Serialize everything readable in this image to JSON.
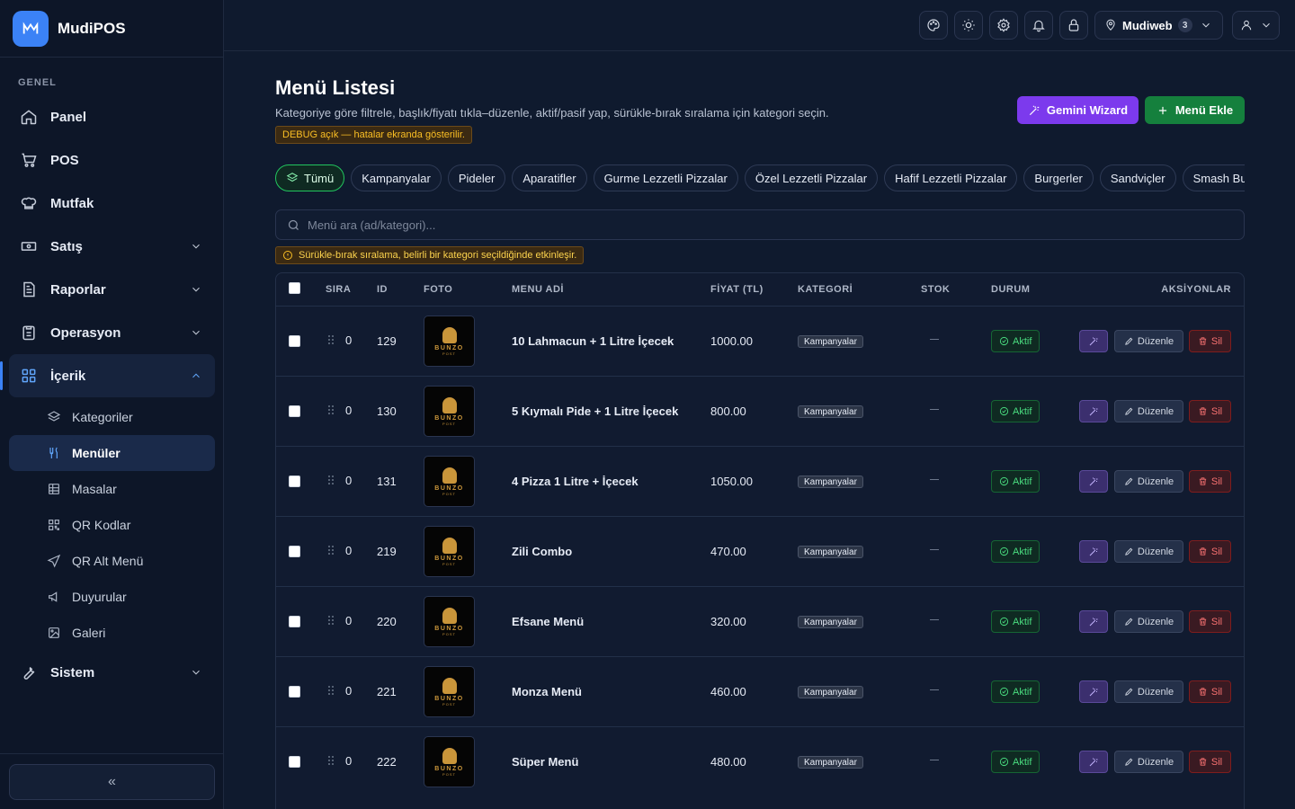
{
  "brand": {
    "logo": "M",
    "name": "MudiPOS"
  },
  "sidebar": {
    "section_label": "GENEL",
    "items": [
      {
        "label": "Panel",
        "icon": "home-icon"
      },
      {
        "label": "POS",
        "icon": "cart-icon"
      },
      {
        "label": "Mutfak",
        "icon": "chef-icon"
      },
      {
        "label": "Satış",
        "icon": "cash-icon",
        "chevron": "down"
      },
      {
        "label": "Raporlar",
        "icon": "report-icon",
        "chevron": "down"
      },
      {
        "label": "Operasyon",
        "icon": "clipboard-icon",
        "chevron": "down"
      },
      {
        "label": "İçerik",
        "icon": "grid-icon",
        "chevron": "up",
        "active": true
      },
      {
        "label": "Sistem",
        "icon": "wrench-icon",
        "chevron": "down"
      }
    ],
    "sub_items": [
      {
        "label": "Kategoriler",
        "icon": "layers-icon"
      },
      {
        "label": "Menüler",
        "icon": "utensils-icon",
        "active": true
      },
      {
        "label": "Masalar",
        "icon": "table-icon"
      },
      {
        "label": "QR Kodlar",
        "icon": "qr-icon"
      },
      {
        "label": "QR Alt Menü",
        "icon": "send-icon"
      },
      {
        "label": "Duyurular",
        "icon": "megaphone-icon"
      },
      {
        "label": "Galeri",
        "icon": "image-icon"
      }
    ],
    "collapse_label": "«"
  },
  "topbar": {
    "user_label": "Mudiweb",
    "user_count": "3"
  },
  "page": {
    "title": "Menü Listesi",
    "subtitle": "Kategoriye göre filtrele, başlık/fiyatı tıkla–düzenle, aktif/pasif yap, sürükle-bırak sıralama için kategori seçin.",
    "debug": "DEBUG açık — hatalar ekranda gösterilir.",
    "gemini_label": "Gemini Wizard",
    "add_label": "Menü Ekle",
    "search_placeholder": "Menü ara (ad/kategori)...",
    "warning": "Sürükle-bırak sıralama, belirli bir kategori seçildiğinde etkinleşir."
  },
  "chips": [
    "Tümü",
    "Kampanyalar",
    "Pideler",
    "Aparatifler",
    "Gurme Lezzetli Pizzalar",
    "Özel Lezzetli Pizzalar",
    "Hafif Lezzetli Pizzalar",
    "Burgerler",
    "Sandviçler",
    "Smash Burger"
  ],
  "table": {
    "headers": {
      "sira": "SIRA",
      "id": "ID",
      "foto": "FOTO",
      "menu": "MENU ADİ",
      "fiyat": "FİYAT (TL)",
      "kategori": "KATEGORİ",
      "stok": "STOK",
      "durum": "DURUM",
      "aksiyon": "AKSİYONLAR"
    },
    "photo_brand": "BUNZO",
    "photo_brand_sub": "POST",
    "status_label": "Aktif",
    "edit_label": "Düzenle",
    "delete_label": "Sil",
    "rows": [
      {
        "sira": "0",
        "id": "129",
        "name": "10 Lahmacun + 1 Litre İçecek",
        "price": "1000.00",
        "category": "Kampanyalar"
      },
      {
        "sira": "0",
        "id": "130",
        "name": "5 Kıymalı Pide + 1 Litre İçecek",
        "price": "800.00",
        "category": "Kampanyalar"
      },
      {
        "sira": "0",
        "id": "131",
        "name": "4 Pizza 1 Litre + İçecek",
        "price": "1050.00",
        "category": "Kampanyalar"
      },
      {
        "sira": "0",
        "id": "219",
        "name": "Zili Combo",
        "price": "470.00",
        "category": "Kampanyalar"
      },
      {
        "sira": "0",
        "id": "220",
        "name": "Efsane Menü",
        "price": "320.00",
        "category": "Kampanyalar"
      },
      {
        "sira": "0",
        "id": "221",
        "name": "Monza Menü",
        "price": "460.00",
        "category": "Kampanyalar"
      },
      {
        "sira": "0",
        "id": "222",
        "name": "Süper Menü",
        "price": "480.00",
        "category": "Kampanyalar"
      }
    ]
  }
}
